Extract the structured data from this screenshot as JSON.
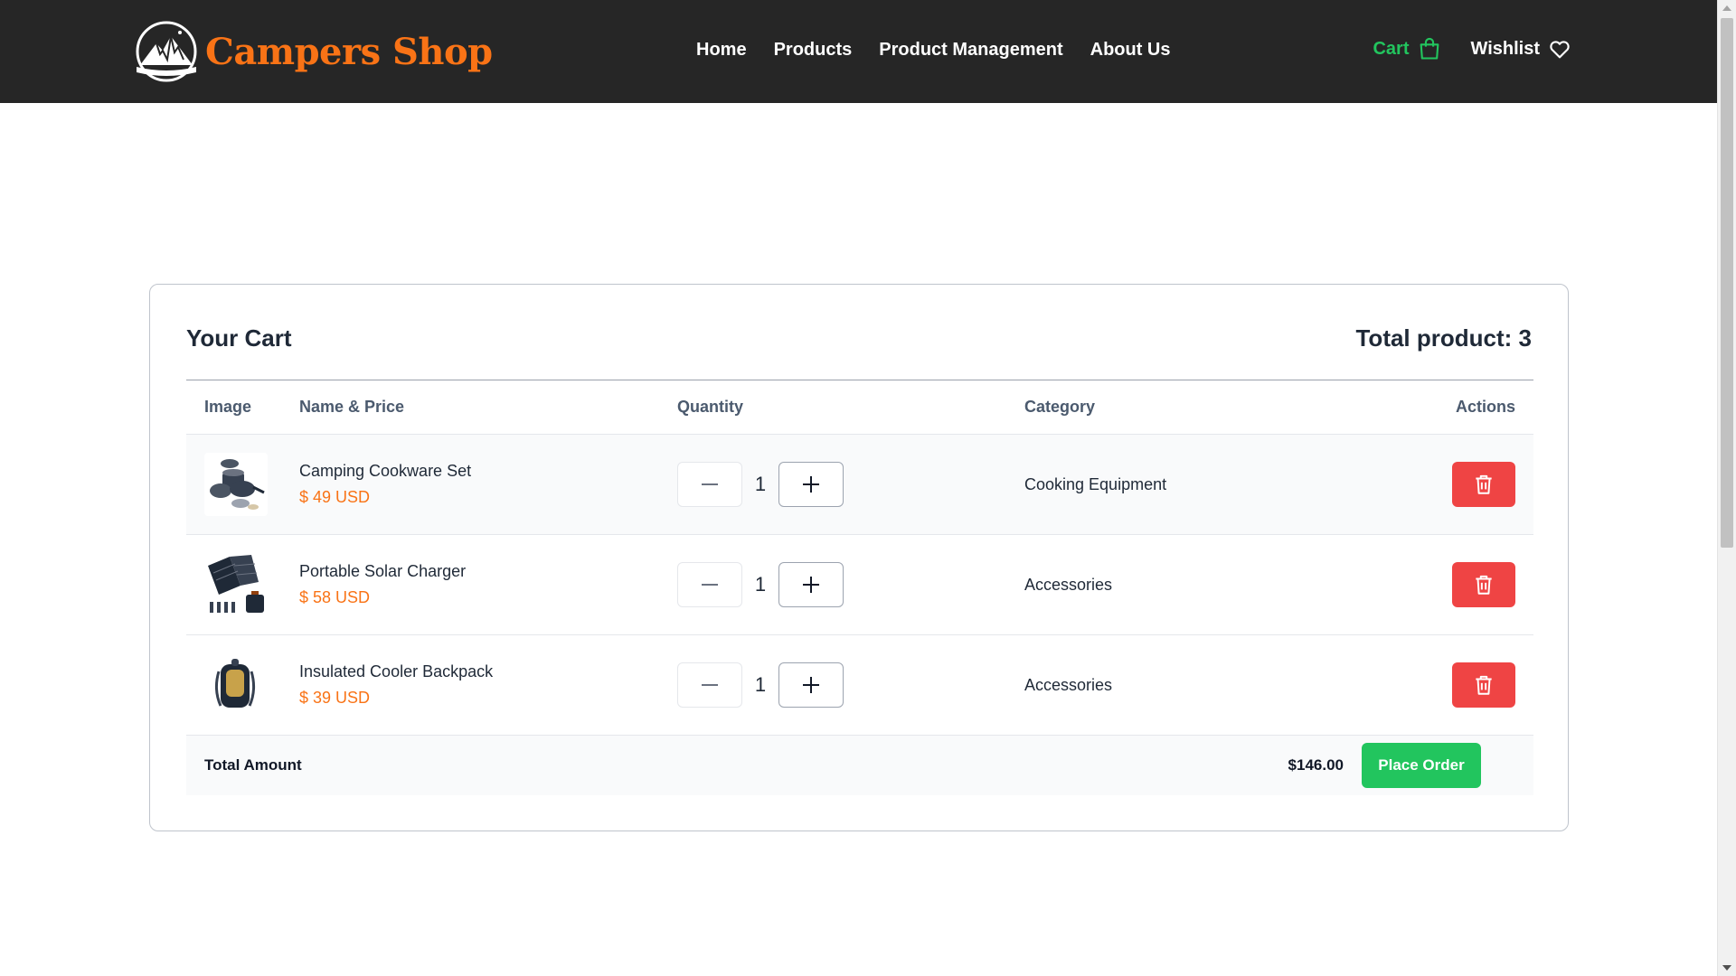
{
  "header": {
    "brand": "Campers Shop",
    "nav": [
      "Home",
      "Products",
      "Product Management",
      "About Us"
    ],
    "cart_label": "Cart",
    "wishlist_label": "Wishlist",
    "accent": "#22c55e",
    "brand_color": "#f97316"
  },
  "cart": {
    "title": "Your Cart",
    "total_products": "Total product: 3",
    "columns": {
      "image": "Image",
      "name_price": "Name & Price",
      "quantity": "Quantity",
      "category": "Category",
      "actions": "Actions"
    },
    "items": [
      {
        "name": "Camping Cookware Set",
        "price": "$ 49 USD",
        "quantity": "1",
        "category": "Cooking Equipment",
        "image_icon": "cookware-set-image"
      },
      {
        "name": "Portable Solar Charger",
        "price": "$ 58 USD",
        "quantity": "1",
        "category": "Accessories",
        "image_icon": "solar-charger-image"
      },
      {
        "name": "Insulated Cooler Backpack",
        "price": "$ 39 USD",
        "quantity": "1",
        "category": "Accessories",
        "image_icon": "cooler-backpack-image"
      }
    ],
    "total_label": "Total Amount",
    "total_amount": "$146.00",
    "place_order": "Place Order",
    "delete_color": "#ef4444"
  }
}
